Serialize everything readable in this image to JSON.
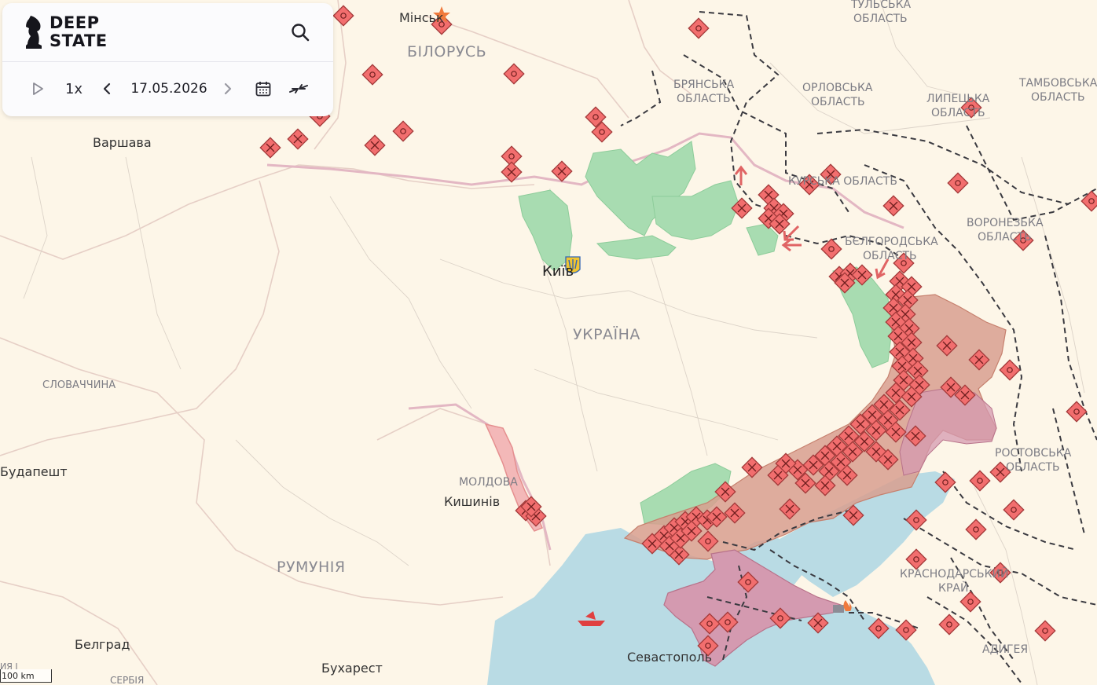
{
  "brand": {
    "line1": "DEEP",
    "line2": "STATE"
  },
  "controls": {
    "speed": "1x",
    "date": "17.05.2026",
    "icons": [
      "play-icon",
      "chevron-left-icon",
      "chevron-right-icon",
      "calendar-icon",
      "collapse-arrows-icon",
      "search-icon"
    ]
  },
  "colors": {
    "background": "#fdf6e8",
    "sea": "#b9dbe4",
    "occupied": "#d89f8f",
    "crimea": "#d49ab0",
    "liberated": "#a8dcb1",
    "transnistria": "#f3b8b8",
    "marker": "#f26e6e"
  },
  "labels": {
    "countries": {
      "belarus": "БІЛОРУСЬ",
      "ukraine": "УКРАЇНА",
      "romania": "РУМУНІЯ",
      "moldova": "МОЛДОВА",
      "slovakia": "СЛОВАЧЧИНА",
      "serbia": "СЕРБІЯ"
    },
    "oblasts": {
      "tula": [
        "ТУЛЬСЬКА",
        "ОБЛАСТЬ"
      ],
      "bryansk": [
        "БРЯНСЬКА",
        "ОБЛАСТЬ"
      ],
      "oryol": [
        "ОРЛОВСЬКА",
        "ОБЛАСТЬ"
      ],
      "lipetsk": [
        "ЛИПЕЦЬКА",
        "ОБЛАСТЬ"
      ],
      "tambov": [
        "ТАМБОВСЬКА",
        "ОБЛАСТЬ"
      ],
      "kursk": "КУРСЬКА ОБЛАСТЬ",
      "voronezh": [
        "ВОРОНЕЗЬКА",
        "ОБЛАСТЬ"
      ],
      "belgorod": [
        "БЄЛГОРОДСЬКА",
        "ОБЛАСТЬ"
      ],
      "rostov": [
        "РОСТОВСЬКА",
        "ОБЛАСТЬ"
      ],
      "krasnodar": [
        "КРАСНОДАРСЬКИЙ",
        "КРАЙ"
      ],
      "adygea": "АДИГЕЯ"
    },
    "cities": {
      "minsk": "Мінськ",
      "warsaw": "Варшава",
      "kyiv": "Київ",
      "budapest": "Будапешт",
      "chisinau": "Кишинів",
      "belgrade": "Белград",
      "bucharest": "Бухарест",
      "sevastopol": "Севастополь",
      "edge": "ИЯ І"
    }
  },
  "scale": {
    "label": "100 km"
  }
}
